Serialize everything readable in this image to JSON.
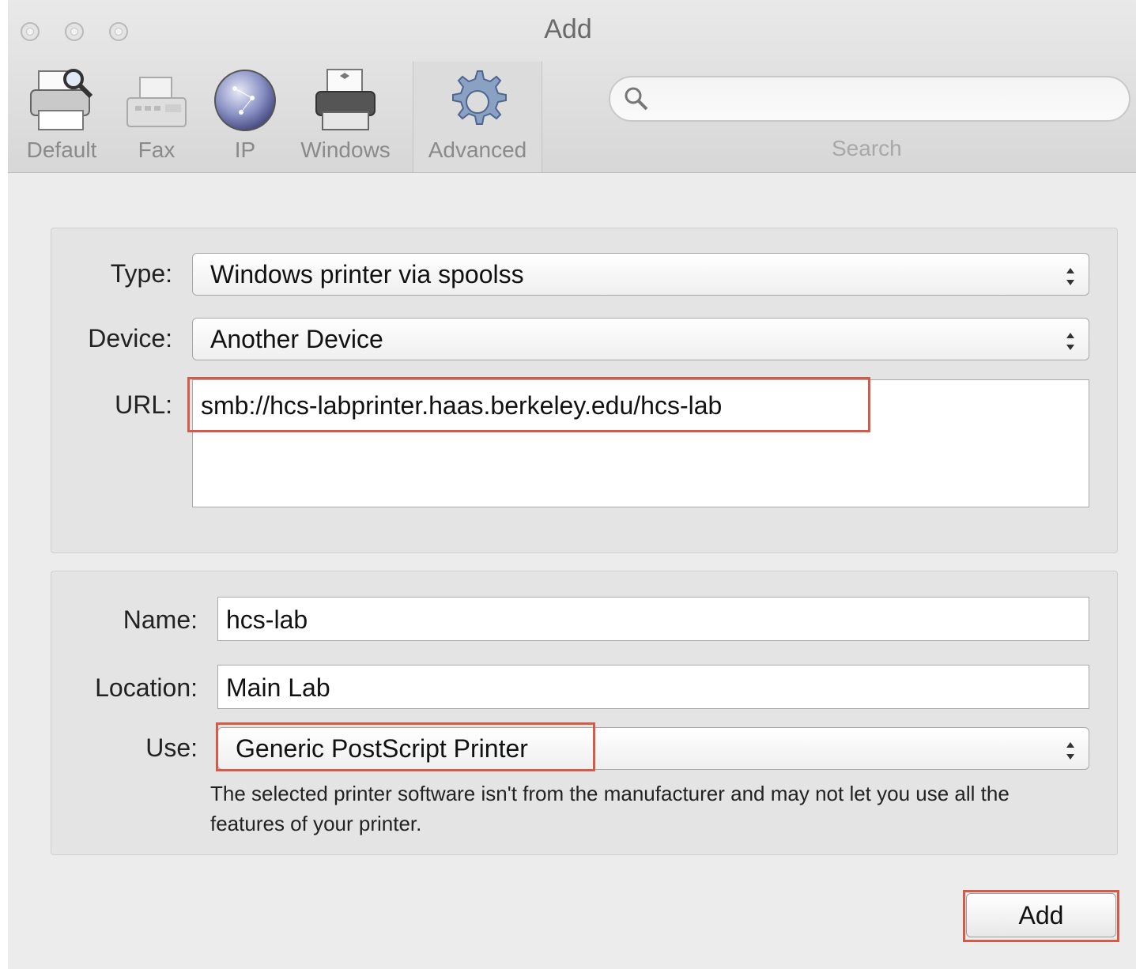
{
  "window": {
    "title": "Add"
  },
  "toolbar": {
    "items": [
      {
        "label": "Default",
        "icon": "printer-magnifier-icon"
      },
      {
        "label": "Fax",
        "icon": "fax-icon"
      },
      {
        "label": "IP",
        "icon": "globe-icon"
      },
      {
        "label": "Windows",
        "icon": "windows-printer-icon"
      },
      {
        "label": "Advanced",
        "icon": "gear-icon",
        "selected": true
      }
    ],
    "search": {
      "label": "Search",
      "value": "",
      "icon": "search-icon"
    }
  },
  "connection": {
    "type_label": "Type:",
    "type_value": "Windows printer via spoolss",
    "device_label": "Device:",
    "device_value": "Another Device",
    "url_label": "URL:",
    "url_value": "smb://hcs-labprinter.haas.berkeley.edu/hcs-lab"
  },
  "details": {
    "name_label": "Name:",
    "name_value": "hcs-lab",
    "location_label": "Location:",
    "location_value": "Main Lab",
    "use_label": "Use:",
    "use_value": "Generic PostScript Printer",
    "note": "The selected printer software isn't from the manufacturer and may not let you use all the features of your printer."
  },
  "actions": {
    "add_label": "Add"
  },
  "colors": {
    "highlight": "#d45a4a"
  }
}
